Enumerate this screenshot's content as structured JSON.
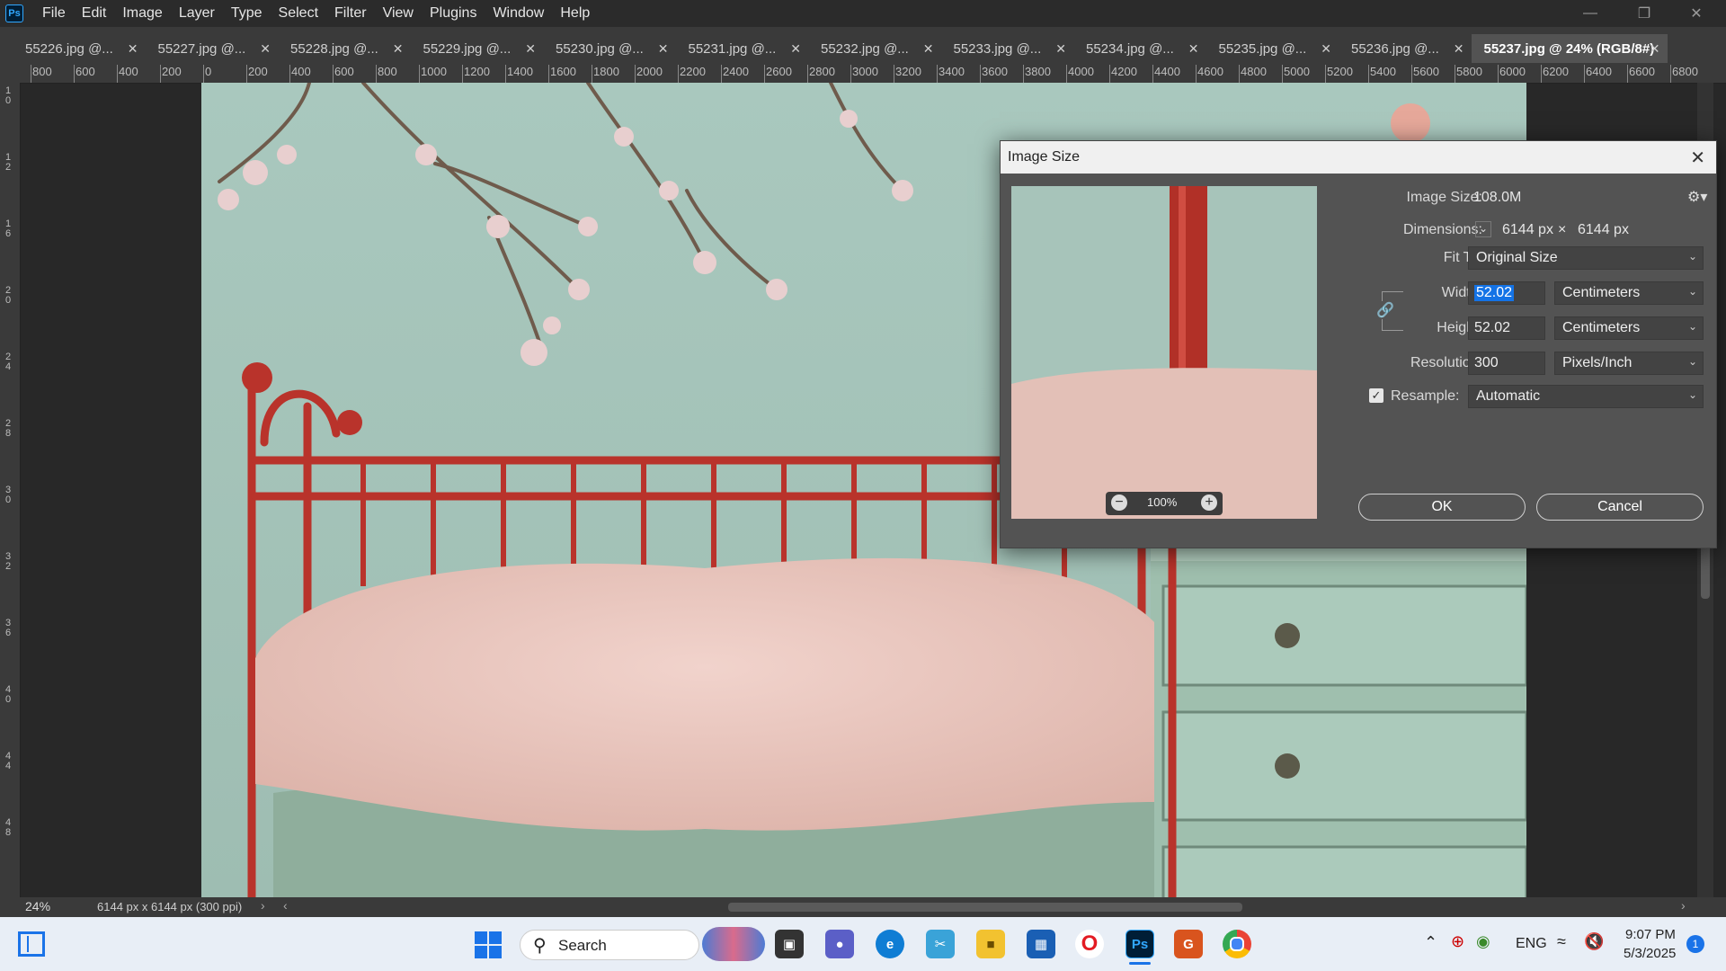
{
  "menubar": {
    "logo": "Ps",
    "items": [
      "File",
      "Edit",
      "Image",
      "Layer",
      "Type",
      "Select",
      "Filter",
      "View",
      "Plugins",
      "Window",
      "Help"
    ]
  },
  "tabs": [
    "55226.jpg @...",
    "55227.jpg @...",
    "55228.jpg @...",
    "55229.jpg @...",
    "55230.jpg @...",
    "55231.jpg @...",
    "55232.jpg @...",
    "55233.jpg @...",
    "55234.jpg @...",
    "55235.jpg @...",
    "55236.jpg @...",
    "55237.jpg @ 24% (RGB/8#)"
  ],
  "ruler_h": [
    "800",
    "600",
    "400",
    "200",
    "0",
    "200",
    "400",
    "600",
    "800",
    "1000",
    "1200",
    "1400",
    "1600",
    "1800",
    "2000",
    "2200",
    "2400",
    "2600",
    "2800",
    "3000",
    "3200",
    "3400",
    "3600",
    "3800",
    "4000",
    "4200",
    "4400",
    "4600",
    "4800",
    "5000",
    "5200",
    "5400",
    "5600",
    "5800",
    "6000",
    "6200",
    "6400",
    "6600",
    "6800"
  ],
  "ruler_v": [
    "1 0",
    "1 2",
    "1 6",
    "2 0",
    "2 4",
    "2 8",
    "3 0",
    "3 2",
    "3 6",
    "4 0",
    "4 4",
    "4 8"
  ],
  "status": {
    "zoom": "24%",
    "doc_info": "6144 px x 6144 px (300 ppi)"
  },
  "dialog": {
    "title": "Image Size",
    "image_size_label": "Image Size:",
    "image_size_value": "108.0M",
    "dimensions_label": "Dimensions:",
    "dim_width": "6144 px",
    "dim_x": "×",
    "dim_height": "6144 px",
    "fit_label": "Fit T...",
    "fit_value": "Original Size",
    "width_label": "Width:",
    "width_value": "52.02",
    "width_unit": "Centimeters",
    "height_label": "Height:",
    "height_value": "52.02",
    "height_unit": "Centimeters",
    "resolution_label": "Resolution:",
    "resolution_value": "300",
    "resolution_unit": "Pixels/Inch",
    "resample_label": "Resample:",
    "resample_checked": true,
    "resample_value": "Automatic",
    "preview_zoom": "100%",
    "ok_label": "OK",
    "cancel_label": "Cancel"
  },
  "taskbar": {
    "search_placeholder": "Search",
    "lang": "ENG",
    "time": "9:07 PM",
    "date": "5/3/2025",
    "notification_count": "1"
  },
  "colors": {
    "wall": "#a3c3b9",
    "bed_red": "#b9332b",
    "fur_pink": "#eac7bf",
    "fur_green": "#8fae9c",
    "dresser": "#a8c7b6",
    "accent_blue": "#1473e6"
  }
}
